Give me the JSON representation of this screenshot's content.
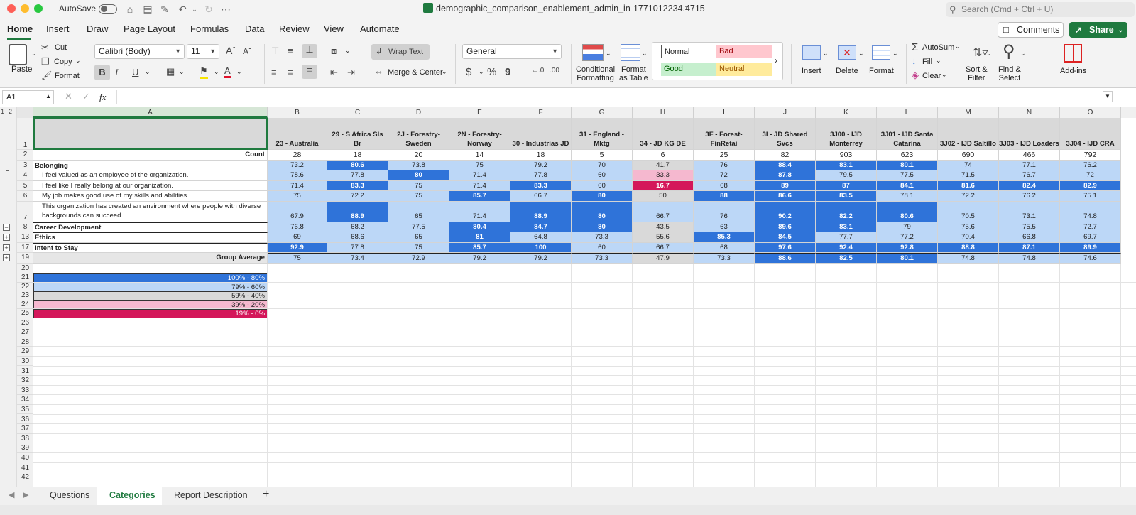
{
  "window": {
    "autosave_label": "AutoSave",
    "file_name": "demographic_comparison_enablement_admin_in-1771012234.4715",
    "search_placeholder": "Search (Cmd + Ctrl + U)"
  },
  "ribbon_tabs": [
    "Home",
    "Insert",
    "Draw",
    "Page Layout",
    "Formulas",
    "Data",
    "Review",
    "View",
    "Automate"
  ],
  "top_buttons": {
    "comments": "Comments",
    "share": "Share"
  },
  "ribbon": {
    "paste": "Paste",
    "cut": "Cut",
    "copy": "Copy",
    "format_painter": "Format",
    "font_name": "Calibri (Body)",
    "font_size": "11",
    "bold": "B",
    "italic": "I",
    "underline": "U",
    "wrap_text": "Wrap Text",
    "merge_center": "Merge & Center",
    "number_format": "General",
    "currency": "$",
    "percent": "%",
    "comma": "9",
    "conditional_formatting": [
      "Conditional",
      "Formatting"
    ],
    "format_as_table": [
      "Format",
      "as Table"
    ],
    "styles": {
      "normal": "Normal",
      "bad": "Bad",
      "good": "Good",
      "neutral": "Neutral"
    },
    "insert": "Insert",
    "delete": "Delete",
    "format": "Format",
    "autosum": "AutoSum",
    "fill": "Fill",
    "clear": "Clear",
    "sort_filter": [
      "Sort &",
      "Filter"
    ],
    "find_select": [
      "Find &",
      "Select"
    ],
    "add_ins": "Add-ins"
  },
  "formula_bar": {
    "name_box": "A1",
    "fx": "fx",
    "content": ""
  },
  "outline_levels": [
    "1",
    "2"
  ],
  "columns": [
    "A",
    "B",
    "C",
    "D",
    "E",
    "F",
    "G",
    "H",
    "I",
    "J",
    "K",
    "L",
    "M",
    "N",
    "O"
  ],
  "header_row": [
    "",
    "23 - Australia",
    "29 - S Africa Sls Br",
    "2J - Forestry-Sweden",
    "2N - Forestry-Norway",
    "30 - Industrias JD",
    "31 - England - Mktg",
    "34 - JD KG DE",
    "3F - Forest-FinRetai",
    "3I - JD Shared Svcs",
    "3J00 - IJD Monterrey",
    "3J01 - IJD Santa Catarina",
    "3J02 - IJD Saltillo",
    "3J03 - IJD Loaders",
    "3J04 - IJD CRA"
  ],
  "data_rows": [
    {
      "row": "2",
      "label": "Count",
      "values": [
        "28",
        "18",
        "20",
        "14",
        "18",
        "5",
        "6",
        "25",
        "82",
        "903",
        "623",
        "690",
        "466",
        "792"
      ],
      "bands": [
        "w",
        "w",
        "w",
        "w",
        "w",
        "w",
        "w",
        "w",
        "w",
        "w",
        "w",
        "w",
        "w",
        "w"
      ]
    },
    {
      "row": "3",
      "label": "Belonging",
      "values": [
        "73.2",
        "80.6",
        "73.8",
        "75",
        "79.2",
        "70",
        "41.7",
        "76",
        "88.4",
        "83.1",
        "80.1",
        "74",
        "77.1",
        "76.2"
      ],
      "bands": [
        "b2",
        "b1",
        "b2",
        "b2",
        "b2",
        "b2",
        "b3",
        "b2",
        "b1",
        "b1",
        "b1",
        "b2",
        "b2",
        "b2"
      ]
    },
    {
      "row": "4",
      "label": "I feel valued as an employee of the organization.",
      "values": [
        "78.6",
        "77.8",
        "80",
        "71.4",
        "77.8",
        "60",
        "33.3",
        "72",
        "87.8",
        "79.5",
        "77.5",
        "71.5",
        "76.7",
        "72"
      ],
      "bands": [
        "b2",
        "b2",
        "b1",
        "b2",
        "b2",
        "b2",
        "b4",
        "b2",
        "b1",
        "b2",
        "b2",
        "b2",
        "b2",
        "b2"
      ]
    },
    {
      "row": "5",
      "label": "I feel like I really belong at our organization.",
      "values": [
        "71.4",
        "83.3",
        "75",
        "71.4",
        "83.3",
        "60",
        "16.7",
        "68",
        "89",
        "87",
        "84.1",
        "81.6",
        "82.4",
        "82.9"
      ],
      "bands": [
        "b2",
        "b1",
        "b2",
        "b2",
        "b1",
        "b2",
        "b5",
        "b2",
        "b1",
        "b1",
        "b1",
        "b1",
        "b1",
        "b1"
      ]
    },
    {
      "row": "6",
      "label": "My job makes good use of my skills and abilities.",
      "values": [
        "75",
        "72.2",
        "75",
        "85.7",
        "66.7",
        "80",
        "50",
        "88",
        "86.6",
        "83.5",
        "78.1",
        "72.2",
        "76.2",
        "75.1"
      ],
      "bands": [
        "b2",
        "b2",
        "b2",
        "b1",
        "b2",
        "b1",
        "b3",
        "b1",
        "b1",
        "b1",
        "b2",
        "b2",
        "b2",
        "b2"
      ]
    },
    {
      "row": "7",
      "label": "This organization has created an environment where people with diverse backgrounds can succeed.",
      "values": [
        "67.9",
        "88.9",
        "65",
        "71.4",
        "88.9",
        "80",
        "66.7",
        "76",
        "90.2",
        "82.2",
        "80.6",
        "70.5",
        "73.1",
        "74.8"
      ],
      "bands": [
        "b2",
        "b1",
        "b2",
        "b2",
        "b1",
        "b1",
        "b2",
        "b2",
        "b1",
        "b1",
        "b1",
        "b2",
        "b2",
        "b2"
      ]
    },
    {
      "row": "8",
      "label": "Career Development",
      "values": [
        "76.8",
        "68.2",
        "77.5",
        "80.4",
        "84.7",
        "80",
        "43.5",
        "63",
        "89.6",
        "83.1",
        "79",
        "75.6",
        "75.5",
        "72.7"
      ],
      "bands": [
        "b2",
        "b2",
        "b2",
        "b1",
        "b1",
        "b1",
        "b3",
        "b2",
        "b1",
        "b1",
        "b2",
        "b2",
        "b2",
        "b2"
      ]
    },
    {
      "row": "13",
      "label": "Ethics",
      "values": [
        "69",
        "68.6",
        "65",
        "81",
        "64.8",
        "73.3",
        "55.6",
        "85.3",
        "84.5",
        "77.7",
        "77.2",
        "70.4",
        "66.8",
        "69.7"
      ],
      "bands": [
        "b2",
        "b2",
        "b2",
        "b1",
        "b2",
        "b2",
        "b3",
        "b1",
        "b1",
        "b2",
        "b2",
        "b2",
        "b2",
        "b2"
      ]
    },
    {
      "row": "17",
      "label": "Intent to Stay",
      "values": [
        "92.9",
        "77.8",
        "75",
        "85.7",
        "100",
        "60",
        "66.7",
        "68",
        "97.6",
        "92.4",
        "92.8",
        "88.8",
        "87.1",
        "89.9"
      ],
      "bands": [
        "b1",
        "b2",
        "b2",
        "b1",
        "b1",
        "b2",
        "b2",
        "b2",
        "b1",
        "b1",
        "b1",
        "b1",
        "b1",
        "b1"
      ]
    },
    {
      "row": "19",
      "label": "Group Average",
      "values": [
        "75",
        "73.4",
        "72.9",
        "79.2",
        "79.2",
        "73.3",
        "47.9",
        "73.3",
        "88.6",
        "82.5",
        "80.1",
        "74.8",
        "74.8",
        "74.6"
      ],
      "bands": [
        "b2",
        "b2",
        "b2",
        "b2",
        "b2",
        "b2",
        "b3",
        "b2",
        "b1",
        "b1",
        "b1",
        "b2",
        "b2",
        "b2"
      ]
    }
  ],
  "legend": [
    {
      "row": "21",
      "label": "100% - 80%",
      "band": "b1"
    },
    {
      "row": "22",
      "label": "79% - 60%",
      "band": "b2"
    },
    {
      "row": "23",
      "label": "59% - 40%",
      "band": "b3"
    },
    {
      "row": "24",
      "label": "39% - 20%",
      "band": "b4"
    },
    {
      "row": "25",
      "label": "19% - 0%",
      "band": "b5"
    }
  ],
  "empty_rows": [
    "20",
    "26",
    "27",
    "28",
    "29",
    "30",
    "31",
    "32",
    "33",
    "34",
    "35",
    "36",
    "37",
    "38",
    "39",
    "40",
    "41",
    "42"
  ],
  "band_colors": {
    "w": "#ffffff",
    "b1": "#2f73d9",
    "b2": "#bcd7f7",
    "b3": "#d9d9d9",
    "b4": "#f5b8cf",
    "b5": "#d4175a"
  },
  "sheet_tabs": [
    "Questions",
    "Categories",
    "Report Description"
  ],
  "active_sheet": "Categories"
}
